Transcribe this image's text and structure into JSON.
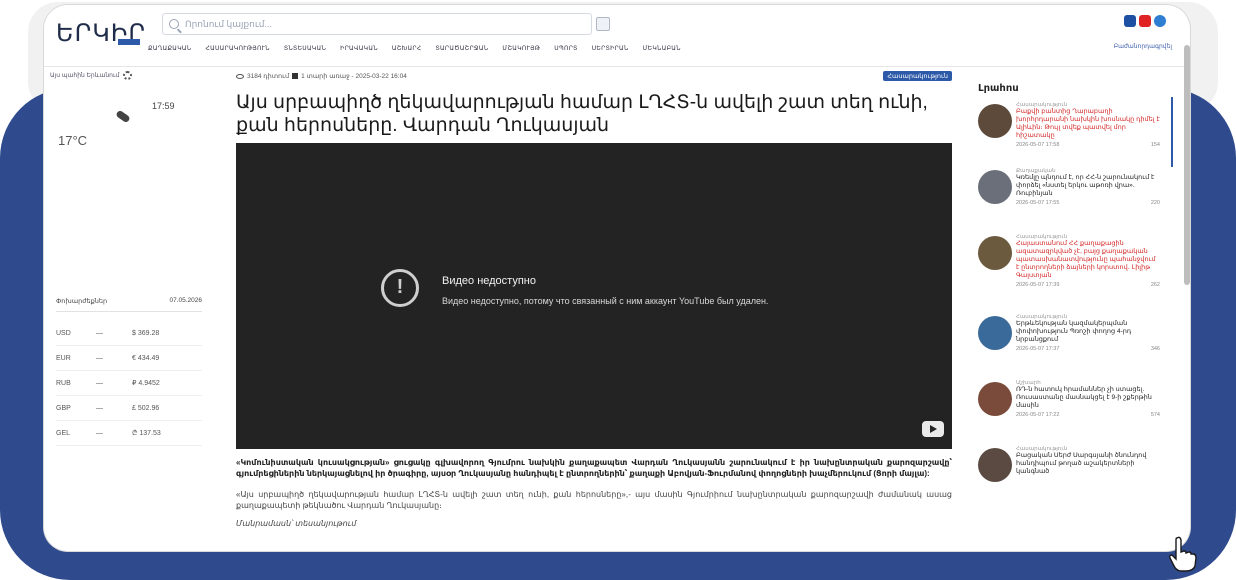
{
  "site": {
    "logo": "ԵՐԿԻՐ",
    "search_placeholder": "Որոնում կայքում...",
    "nav": [
      "ՔԱՂԱՔԱԿԱՆ",
      "ՀԱՍԱՐԱԿՈՒԹՅՈՒՆ",
      "ՏՆՏԵՍԱԿԱՆ",
      "ԻՐԱՎԱԿԱՆ",
      "ԱՇԽԱՐՀ",
      "ՏԱՐԱԾԱՇՐՋԱՆ",
      "ՄՇԱԿՈՒՅԹ",
      "ՍՊՈՐՏ",
      "ՍԵՐՏԻՐԱՆ",
      "ՄԵԿՆԱԲԱՆ"
    ],
    "subscribe": "Բաժանորդագրվել"
  },
  "left": {
    "location": "Այս պահին Երևանում",
    "time": "17:59",
    "temperature": "17°C",
    "rates_label": "Փոխարժեքներ",
    "rates_date": "07.05.2026",
    "rates": [
      {
        "code": "USD",
        "sep": "—",
        "value": "$ 369.28"
      },
      {
        "code": "EUR",
        "sep": "—",
        "value": "€ 434.49"
      },
      {
        "code": "RUB",
        "sep": "—",
        "value": "₽ 4.9452"
      },
      {
        "code": "GBP",
        "sep": "—",
        "value": "£ 502.96"
      },
      {
        "code": "GEL",
        "sep": "—",
        "value": "₾ 137.53"
      }
    ]
  },
  "article": {
    "views": "3184 դիտում",
    "date": "1 տարի առաջ - 2025-03-22 16:04",
    "category": "Հասարակություն",
    "title": "Այս սրբապիղծ ղեկավարության համար ԼՂՀՏ-ն ավելի շատ տեղ ունի, քան հերոսները. Վարդան Ղուկասյան",
    "video_error_title": "Видео недоступно",
    "video_error_msg": "Видео недоступно, потому что связанный с ним аккаунт YouTube был удален.",
    "lead": "«Կոմունիստական կուսակցության» ցուցակը գլխավորող Գյումրու նախկին քաղաքապետ Վարդան Ղուկասյանն շարունակում է իր նախընտրական քարոզարշավը՝ գյումրեցիներին ներկայացնելով իր ծրագիրը, այսօր Ղուկասյանը հանդիպել է ընտրողներին՝ քաղաքի Աբովյան-Ֆուրմանով փողոցների խաչմերուկում (Ցորի մայլա):",
    "para": "«Այս սրբապիղծ ղեկավարության համար ԼՂՀՏ-ն ավելի շատ տեղ ունի, քան հերոսները»,- այս մասին Գյումրիում նախընտրական քարոզարշավի ժամանակ ասաց քաղաքապետի թեկնածու Վարդան Ղուկասյանը։",
    "para2": "Մանրամասն՝ տեսանյութում"
  },
  "sidebar": {
    "title": "Լրահոս",
    "items": [
      {
        "cat": "Հասարակություն",
        "headline": "Բաքվի բանտից Ղարաբաղի խորհրդարանի նախկին խոսնակը դիմել է Ալիևին։ Թույլ տվեք պատվել մոր հիշատակը",
        "red": true,
        "date": "2026-05-07 17:58",
        "views": "154"
      },
      {
        "cat": "Քաղաքական",
        "headline": "Կռեմլը պնդում է, որ ՀՀ-ն շարունակում է փորձել «նստել երկու աթոռի վրա»․ Ռուբինյան",
        "red": false,
        "date": "2026-05-07 17:55",
        "views": "220"
      },
      {
        "cat": "Հասարակություն",
        "headline": "Հայաստանում ՀՀ քաղաքացին ազատազրկված չէ, բայց քաղաքական պատասխանատվությունը պահանջվում է ընտրողների ձայների կորստով․ Լիլիթ Գալստյան",
        "red": true,
        "date": "2026-05-07 17:39",
        "views": "262"
      },
      {
        "cat": "Հասարակություն",
        "headline": "Երթևեկության կազմակերպման փոփոխություն Պռոշի փողոց 4-րդ նրբանցքում",
        "red": false,
        "date": "2026-05-07 17:37",
        "views": "346"
      },
      {
        "cat": "Աշխարհ",
        "headline": "ՌԴ-ն հատուկ հրամաններ չի ստացել. Ռուսաստանը մասնակցել է 9-ի շքերթին մասին",
        "red": false,
        "date": "2026-05-07 17:22",
        "views": "574"
      },
      {
        "cat": "Հասարակություն",
        "headline": "Բացական Սերժ Սարգսյանի ծնունդով հանդիպում թողած աշակերտների կանգնած",
        "red": false,
        "date": "",
        "views": ""
      }
    ]
  },
  "colors": {
    "frame": "#2f4b8e",
    "accent": "#2d5aa8",
    "news_red": "#d32424"
  }
}
